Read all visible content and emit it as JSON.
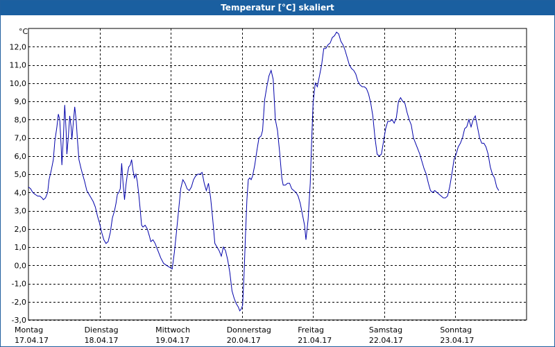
{
  "window": {
    "title": "Temperatur [°C] skaliert"
  },
  "chart_data": {
    "type": "line",
    "title": "Temperatur [°C] skaliert",
    "ylabel": "°C",
    "ylim": [
      -3.0,
      13.0
    ],
    "yticks": [
      "12,0",
      "11,0",
      "10,0",
      "9,0",
      "8,0",
      "7,0",
      "6,0",
      "5,0",
      "4,0",
      "3,0",
      "2,0",
      "1,0",
      "0,0",
      "-1,0",
      "-2,0",
      "-3,0"
    ],
    "xlim": [
      0,
      7
    ],
    "x_categories": [
      {
        "day": "Montag",
        "date": "17.04.17"
      },
      {
        "day": "Dienstag",
        "date": "18.04.17"
      },
      {
        "day": "Mittwoch",
        "date": "19.04.17"
      },
      {
        "day": "Donnerstag",
        "date": "20.04.17"
      },
      {
        "day": "Freitag",
        "date": "21.04.17"
      },
      {
        "day": "Samstag",
        "date": "22.04.17"
      },
      {
        "day": "Sonntag",
        "date": "23.04.17"
      }
    ],
    "grid": true,
    "series": [
      {
        "color": "#0000aa",
        "points": [
          [
            0.0,
            4.3
          ],
          [
            0.03,
            4.2
          ],
          [
            0.06,
            4.0
          ],
          [
            0.09,
            3.9
          ],
          [
            0.13,
            3.8
          ],
          [
            0.16,
            3.8
          ],
          [
            0.19,
            3.7
          ],
          [
            0.21,
            3.6
          ],
          [
            0.24,
            3.7
          ],
          [
            0.27,
            4.0
          ],
          [
            0.29,
            4.7
          ],
          [
            0.32,
            5.2
          ],
          [
            0.35,
            5.8
          ],
          [
            0.37,
            6.8
          ],
          [
            0.4,
            7.6
          ],
          [
            0.42,
            8.3
          ],
          [
            0.44,
            8.0
          ],
          [
            0.46,
            6.5
          ],
          [
            0.47,
            5.5
          ],
          [
            0.49,
            7.0
          ],
          [
            0.51,
            8.8
          ],
          [
            0.53,
            7.3
          ],
          [
            0.54,
            6.1
          ],
          [
            0.56,
            7.0
          ],
          [
            0.58,
            8.2
          ],
          [
            0.6,
            7.6
          ],
          [
            0.61,
            6.9
          ],
          [
            0.63,
            7.8
          ],
          [
            0.65,
            8.7
          ],
          [
            0.67,
            8.0
          ],
          [
            0.69,
            6.8
          ],
          [
            0.71,
            5.8
          ],
          [
            0.74,
            5.3
          ],
          [
            0.76,
            5.0
          ],
          [
            0.79,
            4.6
          ],
          [
            0.82,
            4.1
          ],
          [
            0.85,
            3.9
          ],
          [
            0.88,
            3.7
          ],
          [
            0.91,
            3.5
          ],
          [
            0.94,
            3.2
          ],
          [
            0.97,
            2.7
          ],
          [
            1.0,
            2.3
          ],
          [
            1.03,
            1.8
          ],
          [
            1.06,
            1.4
          ],
          [
            1.09,
            1.2
          ],
          [
            1.12,
            1.3
          ],
          [
            1.15,
            1.8
          ],
          [
            1.18,
            2.6
          ],
          [
            1.21,
            3.0
          ],
          [
            1.23,
            3.4
          ],
          [
            1.25,
            3.9
          ],
          [
            1.27,
            4.0
          ],
          [
            1.29,
            4.2
          ],
          [
            1.31,
            5.6
          ],
          [
            1.33,
            4.5
          ],
          [
            1.35,
            3.6
          ],
          [
            1.37,
            4.4
          ],
          [
            1.39,
            5.0
          ],
          [
            1.41,
            5.4
          ],
          [
            1.43,
            5.5
          ],
          [
            1.45,
            5.8
          ],
          [
            1.47,
            5.2
          ],
          [
            1.49,
            4.8
          ],
          [
            1.51,
            5.0
          ],
          [
            1.53,
            4.6
          ],
          [
            1.55,
            3.9
          ],
          [
            1.57,
            3.1
          ],
          [
            1.59,
            2.2
          ],
          [
            1.61,
            2.1
          ],
          [
            1.64,
            2.2
          ],
          [
            1.67,
            2.0
          ],
          [
            1.7,
            1.6
          ],
          [
            1.72,
            1.3
          ],
          [
            1.75,
            1.4
          ],
          [
            1.78,
            1.2
          ],
          [
            1.82,
            0.8
          ],
          [
            1.86,
            0.4
          ],
          [
            1.9,
            0.1
          ],
          [
            1.94,
            0.0
          ],
          [
            1.98,
            -0.1
          ],
          [
            2.02,
            -0.2
          ],
          [
            2.05,
            0.7
          ],
          [
            2.08,
            1.8
          ],
          [
            2.11,
            3.0
          ],
          [
            2.14,
            4.2
          ],
          [
            2.17,
            4.7
          ],
          [
            2.2,
            4.5
          ],
          [
            2.23,
            4.2
          ],
          [
            2.26,
            4.1
          ],
          [
            2.29,
            4.3
          ],
          [
            2.32,
            4.7
          ],
          [
            2.35,
            4.9
          ],
          [
            2.38,
            5.0
          ],
          [
            2.41,
            5.0
          ],
          [
            2.44,
            5.1
          ],
          [
            2.47,
            4.5
          ],
          [
            2.5,
            4.1
          ],
          [
            2.53,
            4.5
          ],
          [
            2.56,
            3.7
          ],
          [
            2.59,
            2.5
          ],
          [
            2.62,
            1.2
          ],
          [
            2.65,
            1.0
          ],
          [
            2.68,
            0.8
          ],
          [
            2.71,
            0.5
          ],
          [
            2.74,
            1.0
          ],
          [
            2.77,
            0.8
          ],
          [
            2.8,
            0.3
          ],
          [
            2.83,
            -0.4
          ],
          [
            2.86,
            -1.4
          ],
          [
            2.89,
            -1.8
          ],
          [
            2.92,
            -2.1
          ],
          [
            2.95,
            -2.3
          ],
          [
            2.97,
            -2.5
          ],
          [
            2.99,
            -2.4
          ],
          [
            3.01,
            -2.2
          ],
          [
            3.03,
            -0.5
          ],
          [
            3.05,
            1.6
          ],
          [
            3.07,
            3.6
          ],
          [
            3.09,
            4.7
          ],
          [
            3.11,
            4.8
          ],
          [
            3.13,
            4.7
          ],
          [
            3.15,
            4.9
          ],
          [
            3.18,
            5.5
          ],
          [
            3.21,
            6.3
          ],
          [
            3.24,
            7.0
          ],
          [
            3.27,
            7.1
          ],
          [
            3.29,
            7.4
          ],
          [
            3.32,
            9.1
          ],
          [
            3.35,
            9.8
          ],
          [
            3.38,
            10.4
          ],
          [
            3.41,
            10.7
          ],
          [
            3.44,
            10.2
          ],
          [
            3.47,
            8.0
          ],
          [
            3.5,
            7.4
          ],
          [
            3.53,
            6.2
          ],
          [
            3.56,
            4.8
          ],
          [
            3.58,
            4.4
          ],
          [
            3.61,
            4.4
          ],
          [
            3.64,
            4.5
          ],
          [
            3.67,
            4.5
          ],
          [
            3.7,
            4.2
          ],
          [
            3.73,
            4.1
          ],
          [
            3.76,
            4.0
          ],
          [
            3.79,
            3.8
          ],
          [
            3.82,
            3.4
          ],
          [
            3.85,
            2.8
          ],
          [
            3.88,
            2.2
          ],
          [
            3.9,
            1.4
          ],
          [
            3.93,
            2.5
          ],
          [
            3.96,
            4.5
          ],
          [
            3.98,
            6.8
          ],
          [
            4.0,
            8.9
          ],
          [
            4.03,
            10.0
          ],
          [
            4.06,
            9.8
          ],
          [
            4.09,
            10.4
          ],
          [
            4.12,
            11.0
          ],
          [
            4.15,
            11.9
          ],
          [
            4.18,
            11.9
          ],
          [
            4.21,
            12.1
          ],
          [
            4.24,
            12.2
          ],
          [
            4.27,
            12.5
          ],
          [
            4.3,
            12.6
          ],
          [
            4.33,
            12.8
          ],
          [
            4.36,
            12.7
          ],
          [
            4.39,
            12.3
          ],
          [
            4.42,
            12.1
          ],
          [
            4.45,
            11.8
          ],
          [
            4.48,
            11.4
          ],
          [
            4.51,
            11.0
          ],
          [
            4.54,
            10.8
          ],
          [
            4.57,
            10.7
          ],
          [
            4.6,
            10.5
          ],
          [
            4.63,
            10.1
          ],
          [
            4.66,
            9.9
          ],
          [
            4.69,
            9.8
          ],
          [
            4.72,
            9.8
          ],
          [
            4.75,
            9.7
          ],
          [
            4.78,
            9.4
          ],
          [
            4.81,
            8.9
          ],
          [
            4.84,
            8.2
          ],
          [
            4.87,
            7.0
          ],
          [
            4.9,
            6.1
          ],
          [
            4.93,
            6.0
          ],
          [
            4.96,
            6.1
          ],
          [
            4.99,
            6.8
          ],
          [
            5.02,
            7.5
          ],
          [
            5.05,
            7.9
          ],
          [
            5.08,
            7.9
          ],
          [
            5.11,
            8.0
          ],
          [
            5.14,
            7.8
          ],
          [
            5.17,
            8.1
          ],
          [
            5.2,
            9.0
          ],
          [
            5.23,
            9.2
          ],
          [
            5.26,
            9.0
          ],
          [
            5.29,
            8.9
          ],
          [
            5.32,
            8.4
          ],
          [
            5.35,
            8.0
          ],
          [
            5.38,
            7.7
          ],
          [
            5.41,
            7.0
          ],
          [
            5.44,
            6.7
          ],
          [
            5.47,
            6.4
          ],
          [
            5.5,
            6.1
          ],
          [
            5.53,
            5.7
          ],
          [
            5.56,
            5.3
          ],
          [
            5.59,
            5.0
          ],
          [
            5.62,
            4.5
          ],
          [
            5.65,
            4.1
          ],
          [
            5.68,
            4.0
          ],
          [
            5.71,
            4.1
          ],
          [
            5.74,
            4.0
          ],
          [
            5.77,
            3.9
          ],
          [
            5.8,
            3.8
          ],
          [
            5.83,
            3.7
          ],
          [
            5.86,
            3.7
          ],
          [
            5.89,
            3.8
          ],
          [
            5.92,
            4.3
          ],
          [
            5.95,
            5.0
          ],
          [
            5.98,
            5.8
          ],
          [
            6.01,
            6.1
          ],
          [
            6.04,
            6.5
          ],
          [
            6.07,
            6.7
          ],
          [
            6.1,
            7.0
          ],
          [
            6.13,
            7.5
          ],
          [
            6.16,
            7.6
          ],
          [
            6.19,
            8.0
          ],
          [
            6.22,
            7.6
          ],
          [
            6.25,
            8.0
          ],
          [
            6.28,
            8.2
          ],
          [
            6.31,
            7.6
          ],
          [
            6.34,
            7.0
          ],
          [
            6.37,
            6.7
          ],
          [
            6.4,
            6.7
          ],
          [
            6.43,
            6.5
          ],
          [
            6.46,
            6.1
          ],
          [
            6.49,
            5.4
          ],
          [
            6.52,
            5.0
          ],
          [
            6.55,
            4.8
          ],
          [
            6.58,
            4.3
          ],
          [
            6.61,
            4.1
          ]
        ]
      }
    ]
  }
}
